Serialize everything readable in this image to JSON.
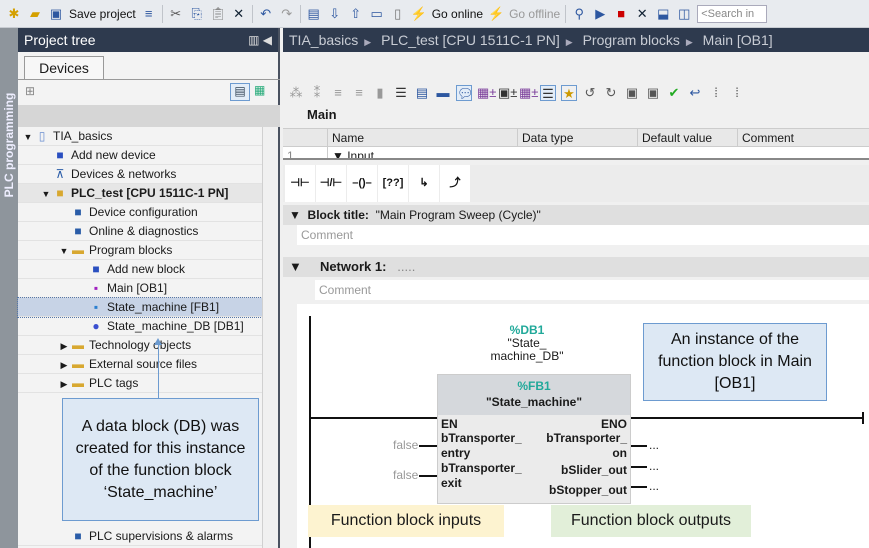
{
  "toolbar": {
    "save_label": "Save project",
    "go_online": "Go online",
    "go_offline": "Go offline",
    "search_placeholder": "<Search in"
  },
  "side_strip": "PLC programming",
  "project_tree": {
    "title": "Project tree",
    "tab": "Devices",
    "items": [
      {
        "label": "TIA_basics",
        "icon": "project-icon",
        "toggle": "▼",
        "indent": 0
      },
      {
        "label": "Add new device",
        "icon": "add-device-icon",
        "indent": 1
      },
      {
        "label": "Devices & networks",
        "icon": "network-icon",
        "indent": 1
      },
      {
        "label": "PLC_test [CPU 1511C-1 PN]",
        "icon": "plc-icon",
        "toggle": "▼",
        "indent": 1,
        "bold": true
      },
      {
        "label": "Device configuration",
        "icon": "device-config-icon",
        "indent": 2
      },
      {
        "label": "Online & diagnostics",
        "icon": "diagnostics-icon",
        "indent": 2
      },
      {
        "label": "Program blocks",
        "icon": "folder-icon",
        "toggle": "▼",
        "indent": 2
      },
      {
        "label": "Add new block",
        "icon": "add-block-icon",
        "indent": 3
      },
      {
        "label": "Main [OB1]",
        "icon": "ob-icon",
        "indent": 3
      },
      {
        "label": "State_machine [FB1]",
        "icon": "fb-icon",
        "indent": 3,
        "selected": true
      },
      {
        "label": "State_machine_DB [DB1]",
        "icon": "db-icon",
        "indent": 3
      },
      {
        "label": "Technology objects",
        "icon": "folder-icon",
        "toggle": "▶",
        "indent": 2
      },
      {
        "label": "External source files",
        "icon": "folder-icon",
        "toggle": "▶",
        "indent": 2
      },
      {
        "label": "PLC tags",
        "icon": "folder-icon",
        "toggle": "▶",
        "indent": 2
      },
      {
        "label": "PLC supervisions & alarms",
        "icon": "alarms-icon",
        "indent": 2
      }
    ]
  },
  "breadcrumb": [
    "TIA_basics",
    "PLC_test [CPU 1511C-1 PN]",
    "Program blocks",
    "Main [OB1]"
  ],
  "editor": {
    "block_name": "Main",
    "interface_columns": [
      "Name",
      "Data type",
      "Default value",
      "Comment"
    ],
    "interface_row": {
      "num": "1",
      "name": "Input"
    },
    "block_title_label": "Block title:",
    "block_title": "\"Main Program Sweep (Cycle)\"",
    "comment_placeholder": "Comment",
    "network_label": "Network 1:",
    "network_title": ".....",
    "fb_instance": {
      "db_addr": "%DB1",
      "db_name": "\"State_\nmachine_DB\"",
      "fb_addr": "%FB1",
      "fb_name": "\"State_machine\"",
      "en": "EN",
      "eno": "ENO",
      "inputs": [
        {
          "name": "bTransporter_\nentry",
          "value": "false"
        },
        {
          "name": "bTransporter_\nexit",
          "value": "false"
        }
      ],
      "outputs": [
        {
          "name": "bTransporter_\non",
          "value": "..."
        },
        {
          "name": "bSlider_out",
          "value": "..."
        },
        {
          "name": "bStopper_out",
          "value": "..."
        }
      ]
    }
  },
  "annotations": {
    "db_callout": "A data block (DB) was created for this instance of the function block ‘State_machine’",
    "instance_callout": "An instance of the function block in Main [OB1]",
    "inputs_label": "Function block inputs",
    "outputs_label": "Function block outputs"
  },
  "colors": {
    "accent_green": "#21a99a",
    "header_navy": "#2e3a4e",
    "callout_bg": "#dde8f4",
    "inputs_bg": "#fdf3d0",
    "outputs_bg": "#e2efd9"
  }
}
